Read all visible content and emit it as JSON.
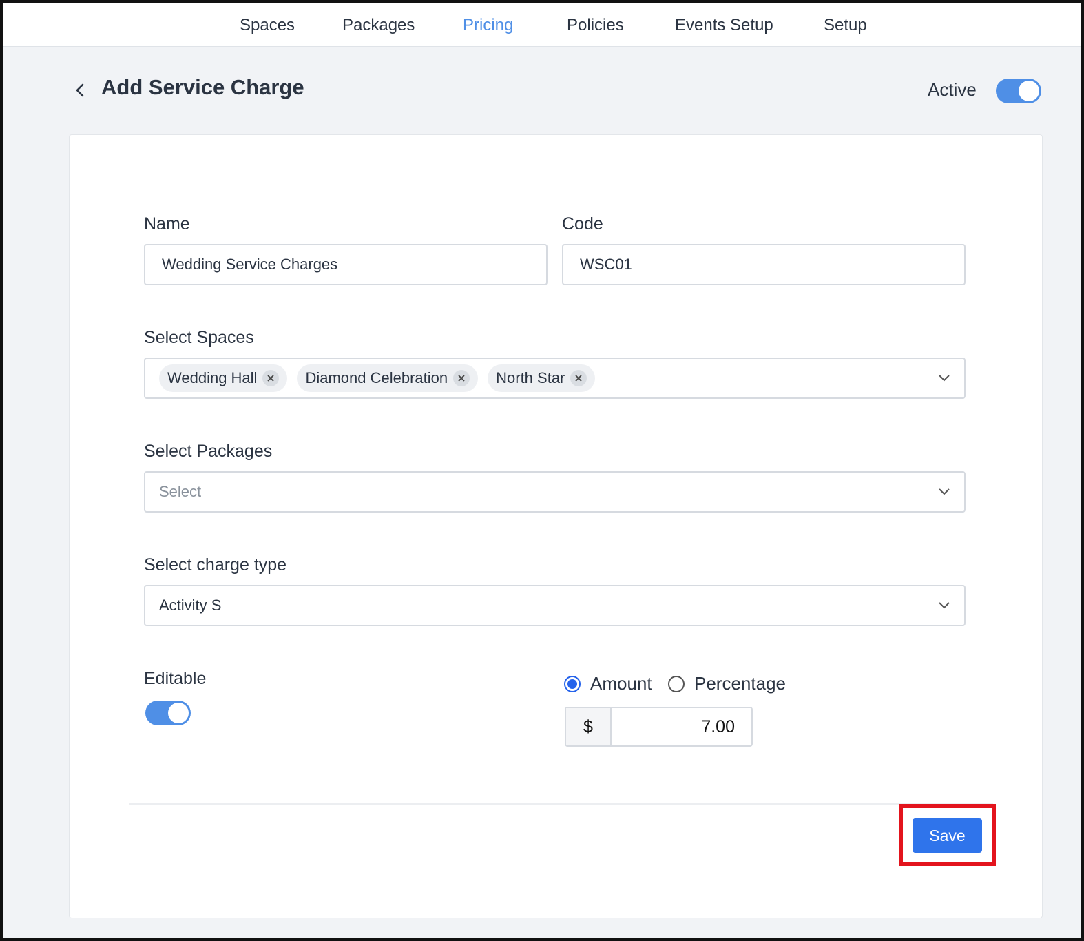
{
  "nav": {
    "items": [
      {
        "label": "Spaces",
        "active": false
      },
      {
        "label": "Packages",
        "active": false
      },
      {
        "label": "Pricing",
        "active": true
      },
      {
        "label": "Policies",
        "active": false
      },
      {
        "label": "Events Setup",
        "active": false
      },
      {
        "label": "Setup",
        "active": false
      }
    ]
  },
  "header": {
    "title": "Add Service Charge",
    "active_label": "Active",
    "active_on": true
  },
  "form": {
    "name_label": "Name",
    "name_value": "Wedding Service Charges",
    "code_label": "Code",
    "code_value": "WSC01",
    "spaces_label": "Select Spaces",
    "spaces": [
      "Wedding Hall",
      "Diamond Celebration",
      "North Star"
    ],
    "packages_label": "Select Packages",
    "packages_placeholder": "Select",
    "charge_type_label": "Select charge type",
    "charge_type_value": "Activity S",
    "editable_label": "Editable",
    "editable_on": true,
    "mode_amount_label": "Amount",
    "mode_percentage_label": "Percentage",
    "selected_mode": "Amount",
    "currency_symbol": "$",
    "amount_value": "7.00",
    "save_label": "Save"
  },
  "colors": {
    "accent": "#4f8fe6",
    "save_button": "#2f74eb",
    "highlight": "#e3141d"
  }
}
